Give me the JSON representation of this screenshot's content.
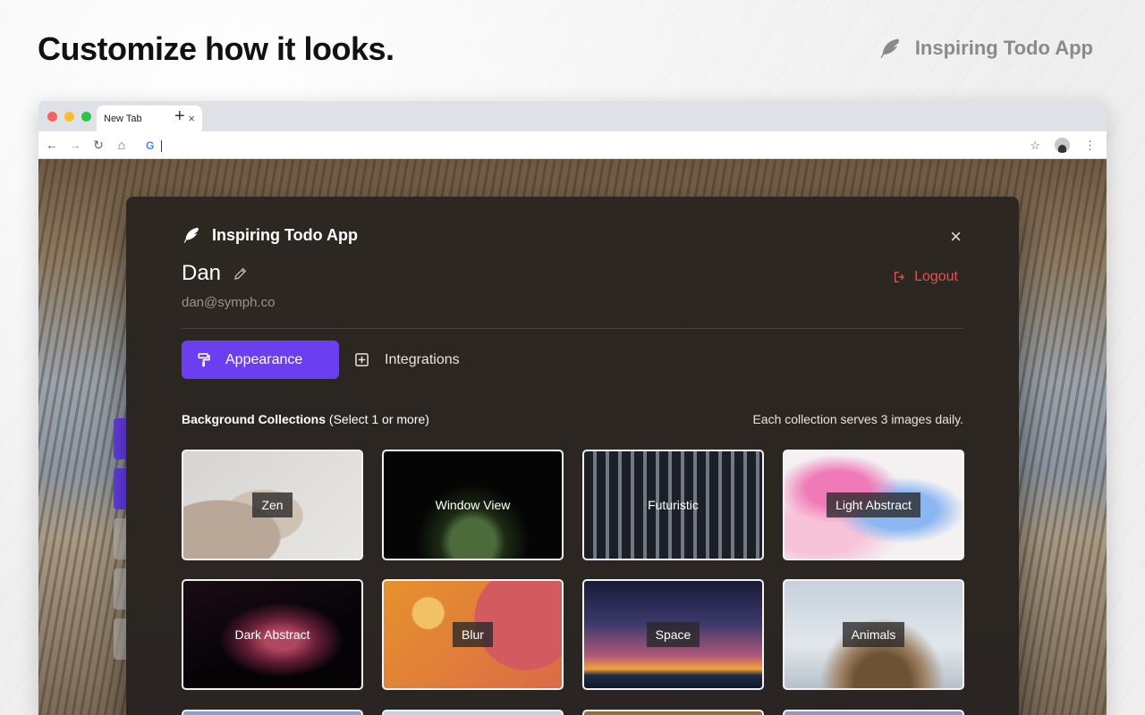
{
  "hero": {
    "headline": "Customize how it looks.",
    "brand_name": "Inspiring Todo App"
  },
  "browser": {
    "tab_title": "New Tab",
    "tab_close": "×",
    "new_tab": "+",
    "omnibox_logo": "G",
    "traffic_lights": [
      "#ff5f57",
      "#febc2e",
      "#28c840"
    ]
  },
  "modal": {
    "brand": "Inspiring Todo App",
    "close": "×",
    "user": {
      "name": "Dan",
      "email": "dan@symph.co"
    },
    "logout_label": "Logout",
    "tabs": [
      {
        "label": "Appearance",
        "active": true
      },
      {
        "label": "Integrations",
        "active": false
      }
    ],
    "section_title": "Background Collections",
    "section_hint": "(Select 1 or more)",
    "section_note": "Each collection serves 3 images daily.",
    "collections": [
      {
        "label": "Zen"
      },
      {
        "label": "Window View"
      },
      {
        "label": "Futuristic"
      },
      {
        "label": "Light Abstract"
      },
      {
        "label": "Dark Abstract"
      },
      {
        "label": "Blur"
      },
      {
        "label": "Space"
      },
      {
        "label": "Animals"
      }
    ]
  },
  "colors": {
    "accent": "#6b3ff0",
    "logout": "#e0554e",
    "modal_bg": "#2d2722"
  },
  "icons": {
    "brand": "feather-icon",
    "edit": "pencil-icon",
    "logout": "logout-icon",
    "appearance": "paint-roller-icon",
    "integrations": "plus-square-icon"
  }
}
